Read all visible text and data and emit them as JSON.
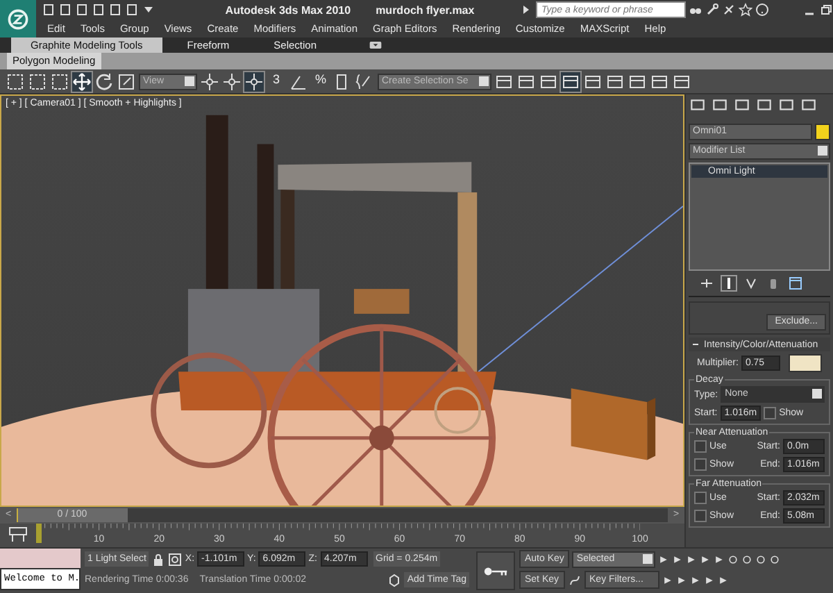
{
  "title_bar": {
    "app": "Autodesk 3ds Max 2010",
    "file": "murdoch flyer.max",
    "search": {
      "placeholder": "Type a keyword or phrase"
    }
  },
  "menu": [
    "Edit",
    "Tools",
    "Group",
    "Views",
    "Create",
    "Modifiers",
    "Animation",
    "Graph Editors",
    "Rendering",
    "Customize",
    "MAXScript",
    "Help"
  ],
  "ribbon": {
    "tabs": [
      {
        "label": "Graphite Modeling Tools",
        "selected": true
      },
      {
        "label": "Freeform",
        "selected": false
      },
      {
        "label": "Selection",
        "selected": false
      }
    ],
    "panel": "Polygon Modeling"
  },
  "toolbar": {
    "reference_coords": "View",
    "snap": "3",
    "percent_snap": "%",
    "selection_set": "Create Selection Se",
    "transform_tools": [
      {
        "kind": "move",
        "selected": true
      },
      {
        "kind": "rotate",
        "selected": false
      },
      {
        "kind": "scale",
        "selected": false
      }
    ]
  },
  "viewport": {
    "label": "[ + ] [ Camera01 ] [ Smooth + Highlights ]"
  },
  "command_panel": {
    "object_name": "Omni01",
    "modifier_list": "Modifier List",
    "stack": [
      {
        "label": "Omni Light",
        "selected": true
      }
    ],
    "exclude_button": "Exclude...",
    "rollout": {
      "title": "Intensity/Color/Attenuation",
      "expanded": true,
      "multiplier_label": "Multiplier:",
      "multiplier": "0.75",
      "decay": {
        "title": "Decay",
        "type_label": "Type:",
        "type": "None",
        "start_label": "Start:",
        "start": "1.016m",
        "show_label": "Show",
        "show": false
      },
      "near": {
        "title": "Near Attenuation",
        "use_label": "Use",
        "use": false,
        "show_label": "Show",
        "show": false,
        "start_label": "Start:",
        "start": "0.0m",
        "end_label": "End:",
        "end": "1.016m"
      },
      "far": {
        "title": "Far Attenuation",
        "use_label": "Use",
        "use": false,
        "show_label": "Show",
        "show": false,
        "start_label": "Start:",
        "start": "2.032m",
        "end_label": "End:",
        "end": "5.08m"
      }
    }
  },
  "time_slider": {
    "label": "0 / 100",
    "level": 0,
    "prev": "<",
    "next": ">"
  },
  "track_bar": {
    "labels": [
      "10",
      "20",
      "30",
      "40",
      "50",
      "60",
      "70",
      "80",
      "90",
      "100"
    ]
  },
  "status": {
    "listener": "Welcome to M.",
    "selection": "1 Light Select",
    "x_label": "X:",
    "x": "-1.101m",
    "y_label": "Y:",
    "y": "6.092m",
    "z_label": "Z:",
    "z": "4.207m",
    "grid": "Grid = 0.254m",
    "rendering_time": "Rendering Time  0:00:36",
    "translation_time": "Translation Time  0:00:02",
    "add_time_tag": "Add Time Tag",
    "auto_key": "Auto Key",
    "key_mode": "Selected",
    "set_key": "Set Key",
    "key_filters": "Key Filters..."
  }
}
